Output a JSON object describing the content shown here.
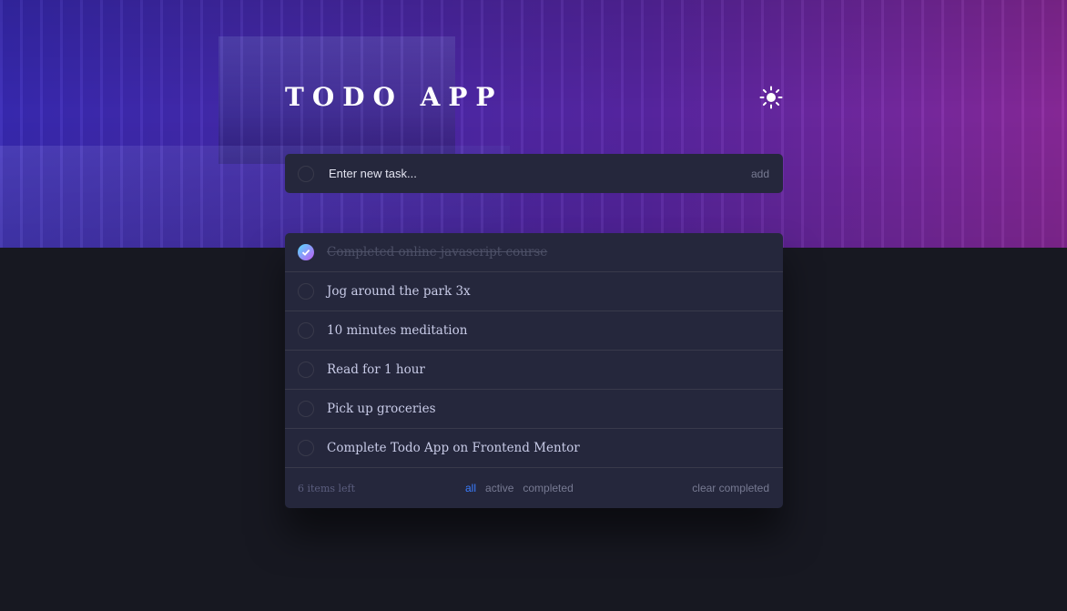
{
  "app": {
    "title": "TODO APP"
  },
  "theme_toggle": {
    "icon": "sun-icon"
  },
  "new_task": {
    "placeholder": "Enter new task...",
    "value": "",
    "add_label": "add"
  },
  "todos": [
    {
      "text": "Completed online javascript course",
      "completed": true
    },
    {
      "text": "Jog around the park 3x",
      "completed": false
    },
    {
      "text": "10 minutes meditation",
      "completed": false
    },
    {
      "text": "Read for 1 hour",
      "completed": false
    },
    {
      "text": "Pick up groceries",
      "completed": false
    },
    {
      "text": "Complete Todo App on Frontend Mentor",
      "completed": false
    }
  ],
  "footer": {
    "items_left": "6 items left",
    "filters": [
      "all",
      "active",
      "completed"
    ],
    "active_filter": "all",
    "clear_label": "clear completed"
  },
  "colors": {
    "accent": "#3a7cfd",
    "check_gradient_start": "#55ddff",
    "check_gradient_end": "#c058f3",
    "card": "#25273c",
    "background": "#171821"
  }
}
